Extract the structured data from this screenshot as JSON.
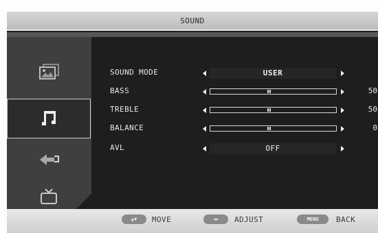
{
  "header": {
    "title": "SOUND"
  },
  "sidebar": {
    "items": [
      {
        "icon": "picture-icon",
        "selected": false
      },
      {
        "icon": "music-note-icon",
        "selected": true
      },
      {
        "icon": "setup-arrow-icon",
        "selected": false
      },
      {
        "icon": "tv-icon",
        "selected": false
      }
    ]
  },
  "settings": {
    "sound_mode": {
      "label": "SOUND MODE",
      "value": "USER"
    },
    "bass": {
      "label": "BASS",
      "value": "50"
    },
    "treble": {
      "label": "TREBLE",
      "value": "50"
    },
    "balance": {
      "label": "BALANCE",
      "value": "0",
      "position": 0.5
    },
    "avl": {
      "label": "AVL",
      "value": "OFF"
    }
  },
  "footer": {
    "move": {
      "key": "▲▼",
      "label": "MOVE"
    },
    "adjust": {
      "key": "◄►",
      "label": "ADJUST"
    },
    "back": {
      "key": "MENU",
      "label": "BACK"
    }
  },
  "colors": {
    "panel": "#1e1e1e",
    "sidebar": "#3f3f3f",
    "text": "#e8e8e8",
    "bars": "#cfcfcf"
  }
}
